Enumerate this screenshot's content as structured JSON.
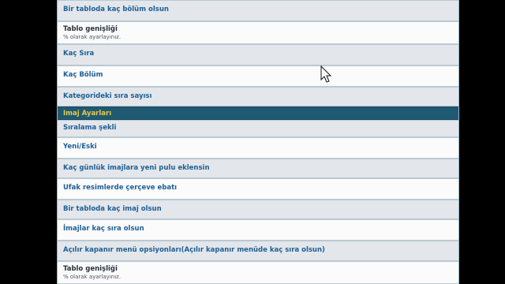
{
  "settings": {
    "rows": [
      {
        "label": "Bir tabloda kaç bölüm olsun",
        "style": "shade"
      },
      {
        "label": "Tablo genişliği",
        "sub": "% olarak ayarlayınız.",
        "style": "white"
      },
      {
        "label": "Kaç Sıra",
        "style": "shade"
      },
      {
        "label": "Kaç Bölüm",
        "style": "white"
      },
      {
        "label": "Kategorideki sıra sayısı",
        "style": "shade"
      },
      {
        "label": "Imaj Ayarları",
        "style": "header"
      },
      {
        "label": "Sıralama şekli",
        "style": "shade"
      },
      {
        "label": "Yeni/Eski",
        "style": "white"
      },
      {
        "label": "Kaç günlük imajlara yeni pulu eklensin",
        "style": "shade"
      },
      {
        "label": "Ufak resimlerde çerçeve ebatı",
        "style": "white"
      },
      {
        "label": "Bir tabloda kaç imaj olsun",
        "style": "shade"
      },
      {
        "label": "İmajlar kaç sıra olsun",
        "style": "white"
      },
      {
        "label": "Açılır kapanır menü opsiyonları(Açılır kapanır menüde kaç sıra olsun)",
        "style": "shade"
      },
      {
        "label": "Tablo genişliği",
        "sub": "% olarak ayarlayınız.",
        "style": "white"
      }
    ]
  },
  "colors": {
    "header_bg": "#205a72",
    "header_text": "#e7c84a",
    "label_text": "#1d5f95",
    "shade_row": "#e3e6ea"
  },
  "icons": {
    "cursor": "mouse-pointer-icon"
  }
}
